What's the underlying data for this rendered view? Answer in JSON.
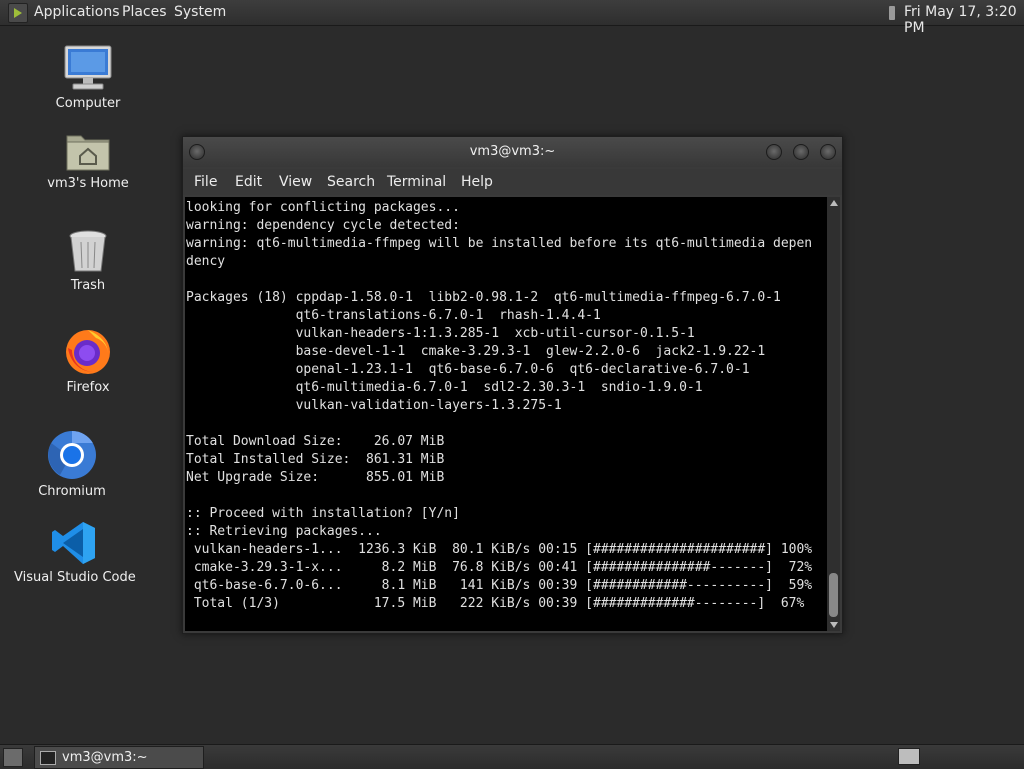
{
  "top_panel": {
    "menus": [
      "Applications",
      "Places",
      "System"
    ],
    "clock": "Fri May 17,  3:20 PM"
  },
  "desktop": {
    "icons": [
      {
        "label": "Computer",
        "icon": "computer-icon"
      },
      {
        "label": "vm3's Home",
        "icon": "home-folder-icon"
      },
      {
        "label": "Trash",
        "icon": "trash-icon"
      },
      {
        "label": "Firefox",
        "icon": "firefox-icon"
      },
      {
        "label": "Chromium",
        "icon": "chromium-icon"
      },
      {
        "label": "Visual Studio Code",
        "icon": "vscode-icon"
      }
    ]
  },
  "terminal": {
    "title": "vm3@vm3:~",
    "menu": [
      "File",
      "Edit",
      "View",
      "Search",
      "Terminal",
      "Help"
    ],
    "lines": [
      "looking for conflicting packages...",
      "warning: dependency cycle detected:",
      "warning: qt6-multimedia-ffmpeg will be installed before its qt6-multimedia depen",
      "dency",
      "",
      "Packages (18) cppdap-1.58.0-1  libb2-0.98.1-2  qt6-multimedia-ffmpeg-6.7.0-1",
      "              qt6-translations-6.7.0-1  rhash-1.4.4-1",
      "              vulkan-headers-1:1.3.285-1  xcb-util-cursor-0.1.5-1",
      "              base-devel-1-1  cmake-3.29.3-1  glew-2.2.0-6  jack2-1.9.22-1",
      "              openal-1.23.1-1  qt6-base-6.7.0-6  qt6-declarative-6.7.0-1",
      "              qt6-multimedia-6.7.0-1  sdl2-2.30.3-1  sndio-1.9.0-1",
      "              vulkan-validation-layers-1.3.275-1",
      "",
      "Total Download Size:    26.07 MiB",
      "Total Installed Size:  861.31 MiB",
      "Net Upgrade Size:      855.01 MiB",
      "",
      ":: Proceed with installation? [Y/n]",
      ":: Retrieving packages...",
      " vulkan-headers-1...  1236.3 KiB  80.1 KiB/s 00:15 [######################] 100%",
      " cmake-3.29.3-1-x...     8.2 MiB  76.8 KiB/s 00:41 [###############-------]  72%",
      " qt6-base-6.7.0-6...     8.1 MiB   141 KiB/s 00:39 [############----------]  59%",
      " Total (1/3)            17.5 MiB   222 KiB/s 00:39 [#############--------]  67%"
    ]
  },
  "taskbar": {
    "task_label": "vm3@vm3:~"
  },
  "colors": {
    "desktop_bg": "#2b2b2b",
    "terminal_bg": "#000000",
    "terminal_fg": "#e0e0e0"
  }
}
